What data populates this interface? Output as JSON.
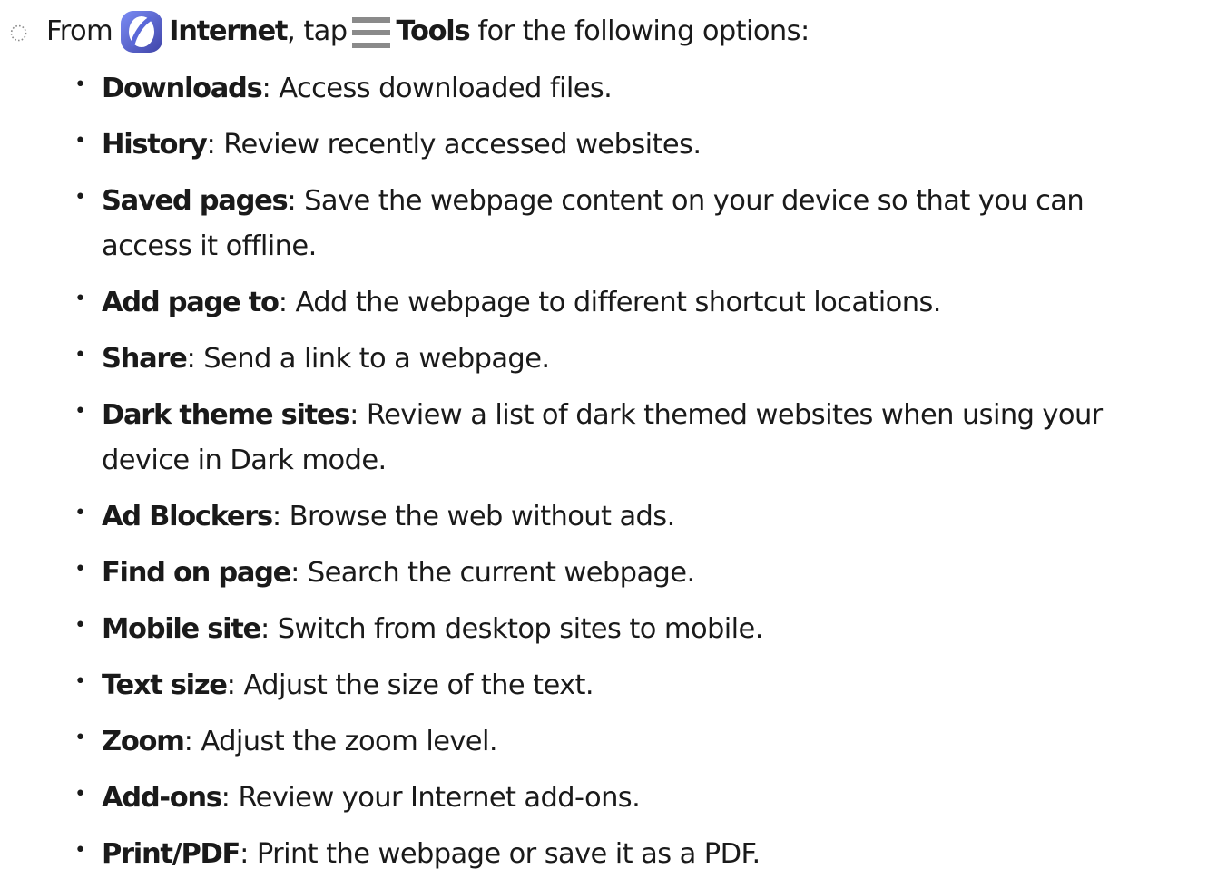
{
  "intro": {
    "prefix": "From",
    "app_name": "Internet",
    "middle": ", tap",
    "menu_name": "Tools",
    "suffix": "for the following options:",
    "icons": {
      "step": "step-marker-icon",
      "app": "internet-app-icon",
      "menu": "hamburger-menu-icon"
    }
  },
  "options": [
    {
      "term": "Downloads",
      "sep": ":",
      "desc": " Access downloaded files."
    },
    {
      "term": "History",
      "sep": ":",
      "desc": " Review recently accessed websites."
    },
    {
      "term": "Saved pages",
      "sep": ":",
      "desc": " Save the webpage content on your device so that you can",
      "desc2": "access it offline."
    },
    {
      "term": "Add page to",
      "sep": ":",
      "desc": " Add the webpage to different shortcut locations."
    },
    {
      "term": "Share",
      "sep": ":",
      "desc": " Send a link to a webpage."
    },
    {
      "term": "Dark theme sites",
      "sep": ":",
      "desc": " Review a list of dark themed websites when using your",
      "desc2": "device in Dark mode."
    },
    {
      "term": "Ad Blockers",
      "sep": ":",
      "desc": " Browse the web without ads."
    },
    {
      "term": "Find on page",
      "sep": ":",
      "desc": " Search the current webpage."
    },
    {
      "term": "Mobile site",
      "sep": ":",
      "desc": " Switch from desktop sites to mobile."
    },
    {
      "term": "Text size",
      "sep": ":",
      "desc": " Adjust the size of the text."
    },
    {
      "term": "Zoom",
      "sep": ":",
      "desc": " Adjust the zoom level."
    },
    {
      "term": "Add-ons",
      "sep": ":",
      "desc": " Review your Internet add-ons."
    },
    {
      "term": "Print/PDF",
      "sep": ":",
      "desc": " Print the webpage or save it as a PDF."
    }
  ],
  "colors": {
    "text": "#1a1a1a",
    "app_icon_dark": "#4a4fb0",
    "app_icon_light": "#6e84f0",
    "menu_icon": "#8a8a8a"
  }
}
